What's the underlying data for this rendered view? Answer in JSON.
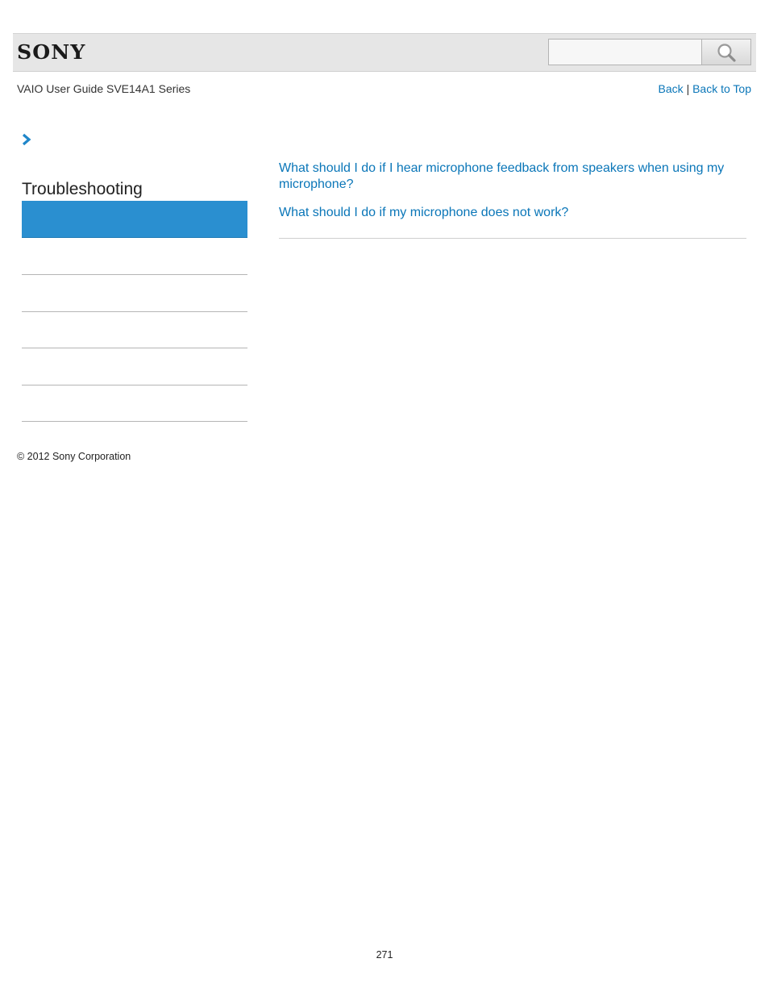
{
  "header": {
    "logo_text": "SONY",
    "search": {
      "value": "",
      "placeholder": ""
    },
    "search_button_icon": "magnifier-icon"
  },
  "guide_title": "VAIO User Guide SVE14A1 Series",
  "nav": {
    "back": "Back",
    "separator": "|",
    "back_to_top": "Back to Top"
  },
  "breadcrumb_icon": "chevron-right-icon",
  "sidebar": {
    "title": "Troubleshooting",
    "items": [
      {
        "label": ""
      },
      {
        "label": ""
      },
      {
        "label": ""
      },
      {
        "label": ""
      },
      {
        "label": ""
      },
      {
        "label": ""
      }
    ]
  },
  "content": {
    "links": [
      {
        "text": "What should I do if I hear microphone feedback from speakers when using my microphone?"
      },
      {
        "text": "What should I do if my microphone does not work?"
      }
    ]
  },
  "footer": {
    "copyright": "© 2012 Sony Corporation",
    "page_number": "271"
  },
  "colors": {
    "link": "#0a76b8",
    "sidebar_active": "#2a8fd0",
    "header_bar": "#e6e6e6"
  }
}
